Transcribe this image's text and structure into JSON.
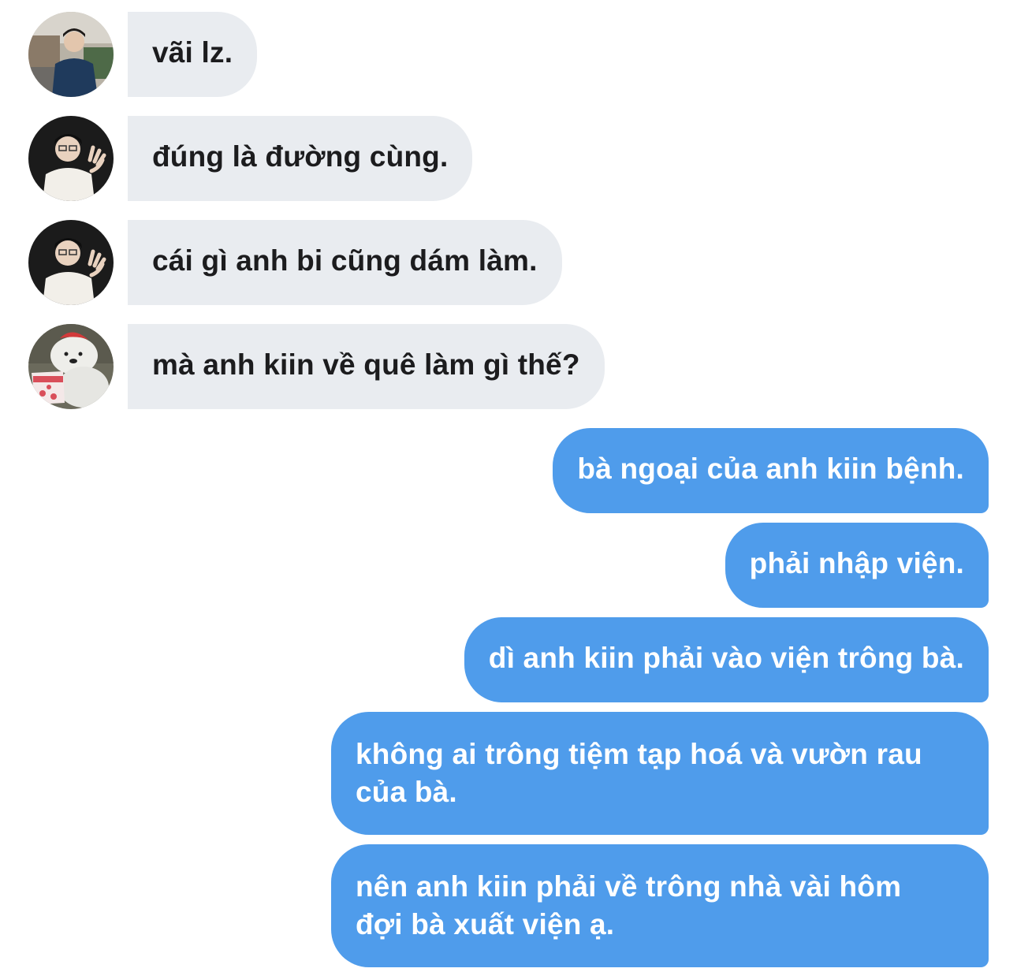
{
  "conversation": {
    "incoming": [
      {
        "text": "vãi lz.",
        "avatar": "person-street-avatar"
      },
      {
        "text": "đúng là đường cùng.",
        "avatar": "person-glasses-avatar"
      },
      {
        "text": "cái gì anh bi cũng dám làm.",
        "avatar": "person-glasses-avatar"
      },
      {
        "text": "mà anh kiin về quê làm gì thế?",
        "avatar": "bear-icecream-avatar"
      }
    ],
    "outgoing": [
      {
        "text": "bà ngoại của anh kiin bệnh."
      },
      {
        "text": "phải nhập viện."
      },
      {
        "text": "dì anh kiin phải vào viện trông bà."
      },
      {
        "lines": [
          "không ai trông tiệm tạp hoá và vườn rau",
          "của bà."
        ]
      },
      {
        "lines": [
          "nên anh kiin phải về trông nhà vài hôm",
          "đợi bà xuất viện ạ."
        ]
      }
    ]
  },
  "colors": {
    "incoming_bubble": "#e9ecf0",
    "incoming_text": "#1c1c1e",
    "outgoing_bubble": "#4f9ceb",
    "outgoing_text": "#ffffff",
    "background": "#ffffff"
  }
}
